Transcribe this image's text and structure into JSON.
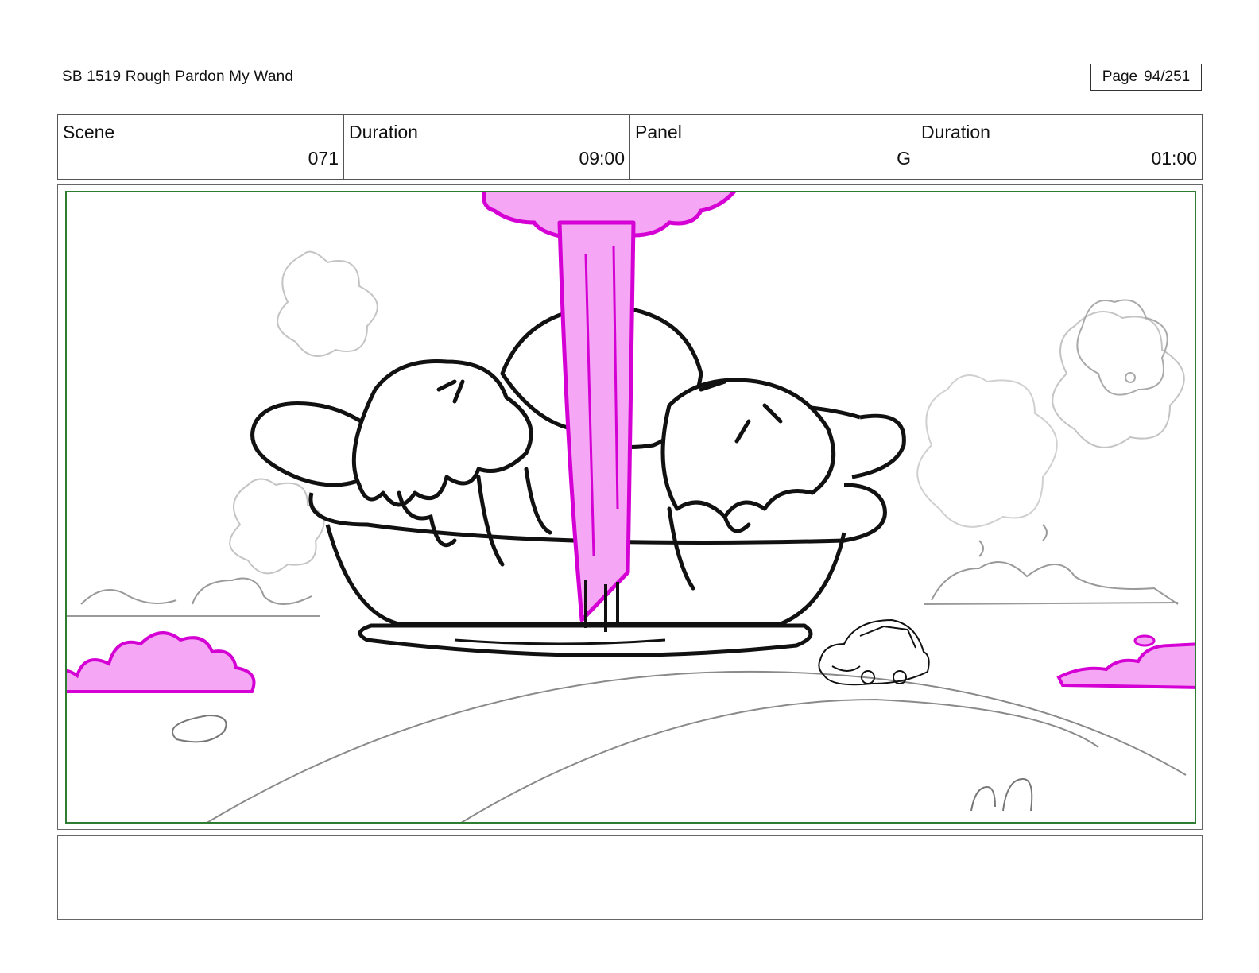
{
  "header": {
    "title": "SB 1519 Rough  Pardon My Wand",
    "page_label": "Page",
    "page_value": "94/251"
  },
  "info": {
    "scene_label": "Scene",
    "scene_value": "071",
    "scene_duration_label": "Duration",
    "scene_duration_value": "09:00",
    "panel_label": "Panel",
    "panel_value": "G",
    "panel_duration_label": "Duration",
    "panel_duration_value": "01:00"
  },
  "colors": {
    "safe_frame": "#2e7d32",
    "magenta_fill": "#f5a6f5",
    "magenta_line": "#d400d4",
    "ink": "#111111",
    "background_sketch": "#b5b5b5"
  },
  "notes": {
    "text": ""
  }
}
